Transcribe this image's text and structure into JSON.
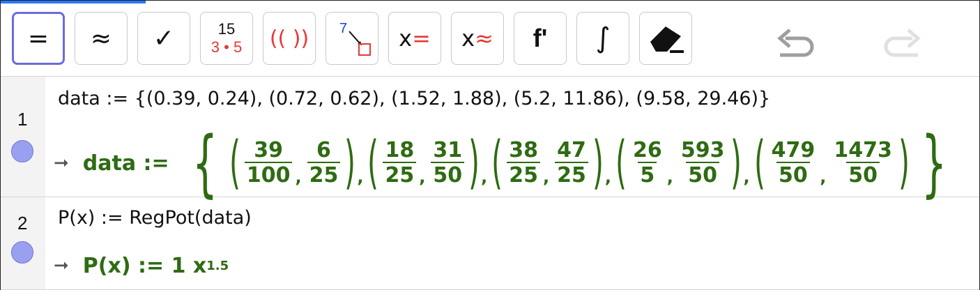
{
  "toolbar": {
    "buttons": {
      "exact": "=",
      "approx": "≈",
      "check": "✓",
      "numeric_top": "15",
      "numeric_bottom": "3 • 5",
      "parens": "(( ))",
      "substitute_num": "7",
      "solve_exact_x": "x",
      "solve_exact_sym": "=",
      "solve_num_x": "x",
      "solve_num_sym": "≈",
      "derivative": "f'",
      "integral": "∫"
    },
    "colors": {
      "selected_border": "#6b6bde",
      "accent_red": "#e53935",
      "accent_blue": "#1a3fd8"
    },
    "icons": [
      "eraser-icon",
      "undo-icon",
      "redo-icon"
    ]
  },
  "rows": [
    {
      "number": "1",
      "input": "data := {(0.39,  0.24), (0.72, 0.62),  (1.52,  1.88), (5.2, 11.86), (9.58, 29.46)}",
      "output": {
        "label": "data :=",
        "pairs": [
          {
            "a_num": "39",
            "a_den": "100",
            "b_num": "6",
            "b_den": "25"
          },
          {
            "a_num": "18",
            "a_den": "25",
            "b_num": "31",
            "b_den": "50"
          },
          {
            "a_num": "38",
            "a_den": "25",
            "b_num": "47",
            "b_den": "25"
          },
          {
            "a_num": "26",
            "a_den": "5",
            "b_num": "593",
            "b_den": "50"
          },
          {
            "a_num": "479",
            "a_den": "50",
            "b_num": "1473",
            "b_den": "50"
          }
        ]
      }
    },
    {
      "number": "2",
      "input": "P(x) := RegPot(data)",
      "output": {
        "label": "P(x) := 1 x",
        "exponent": "1.5"
      }
    }
  ],
  "colors": {
    "output_green": "#2e6b12",
    "dot_fill": "#9aa0f0"
  }
}
